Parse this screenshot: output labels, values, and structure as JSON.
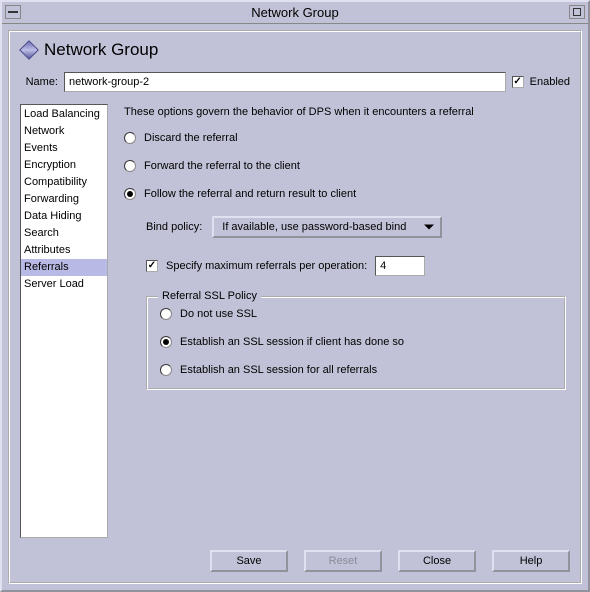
{
  "window": {
    "title": "Network Group"
  },
  "header": {
    "title": "Network Group"
  },
  "name_field": {
    "label": "Name:",
    "value": "network-group-2"
  },
  "enabled": {
    "label": "Enabled",
    "checked": true
  },
  "sidebar": {
    "items": [
      {
        "label": "Load Balancing"
      },
      {
        "label": "Network"
      },
      {
        "label": "Events"
      },
      {
        "label": "Encryption"
      },
      {
        "label": "Compatibility"
      },
      {
        "label": "Forwarding"
      },
      {
        "label": "Data Hiding"
      },
      {
        "label": "Search"
      },
      {
        "label": "Attributes"
      },
      {
        "label": "Referrals"
      },
      {
        "label": "Server Load"
      }
    ],
    "selected_index": 9
  },
  "main": {
    "description": "These options govern the behavior of DPS when it encounters a referral",
    "referral_mode": {
      "options": [
        "Discard the referral",
        "Forward the referral to the client",
        "Follow the referral and return result to client"
      ],
      "selected_index": 2
    },
    "bind_policy": {
      "label": "Bind policy:",
      "value": "If available, use password-based bind"
    },
    "max_referrals": {
      "label": "Specify maximum referrals per operation:",
      "checked": true,
      "value": "4"
    },
    "ssl_policy": {
      "legend": "Referral SSL Policy",
      "options": [
        "Do not use SSL",
        "Establish an SSL session if client has done so",
        "Establish an SSL session for all referrals"
      ],
      "selected_index": 1
    }
  },
  "footer": {
    "save": "Save",
    "reset": "Reset",
    "close": "Close",
    "help": "Help"
  }
}
